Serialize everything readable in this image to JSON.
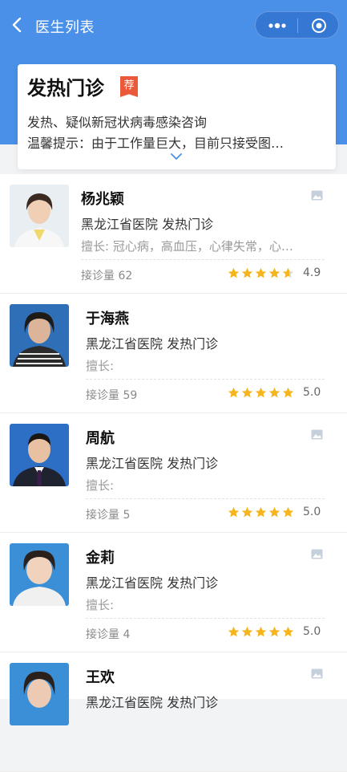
{
  "nav": {
    "title": "医生列表"
  },
  "department": {
    "name": "发热门诊",
    "badge": "荐",
    "desc": "发热、疑似新冠状病毒感染咨询",
    "tip": "温馨提示：由于工作量巨大，目前只接受图…"
  },
  "colors": {
    "accent": "#4a90e8",
    "star": "#f5b51f",
    "badge": "#ea5a3a"
  },
  "doctors": [
    {
      "name": "杨兆颖",
      "hospital": "黑龙江省医院 发热门诊",
      "specialty": "擅长: 冠心病，高血压，心律失常，心…",
      "count": "接诊量 62",
      "score": "4.9",
      "rating": 4.9
    },
    {
      "name": "于海燕",
      "hospital": "黑龙江省医院 发热门诊",
      "specialty": "擅长:",
      "count": "接诊量 59",
      "score": "5.0",
      "rating": 5.0
    },
    {
      "name": "周航",
      "hospital": "黑龙江省医院 发热门诊",
      "specialty": "擅长:",
      "count": "接诊量 5",
      "score": "5.0",
      "rating": 5.0
    },
    {
      "name": "金莉",
      "hospital": "黑龙江省医院 发热门诊",
      "specialty": "擅长:",
      "count": "接诊量 4",
      "score": "5.0",
      "rating": 5.0
    },
    {
      "name": "王欢",
      "hospital": "黑龙江省医院 发热门诊",
      "specialty": "",
      "count": "",
      "score": "",
      "rating": null
    }
  ]
}
